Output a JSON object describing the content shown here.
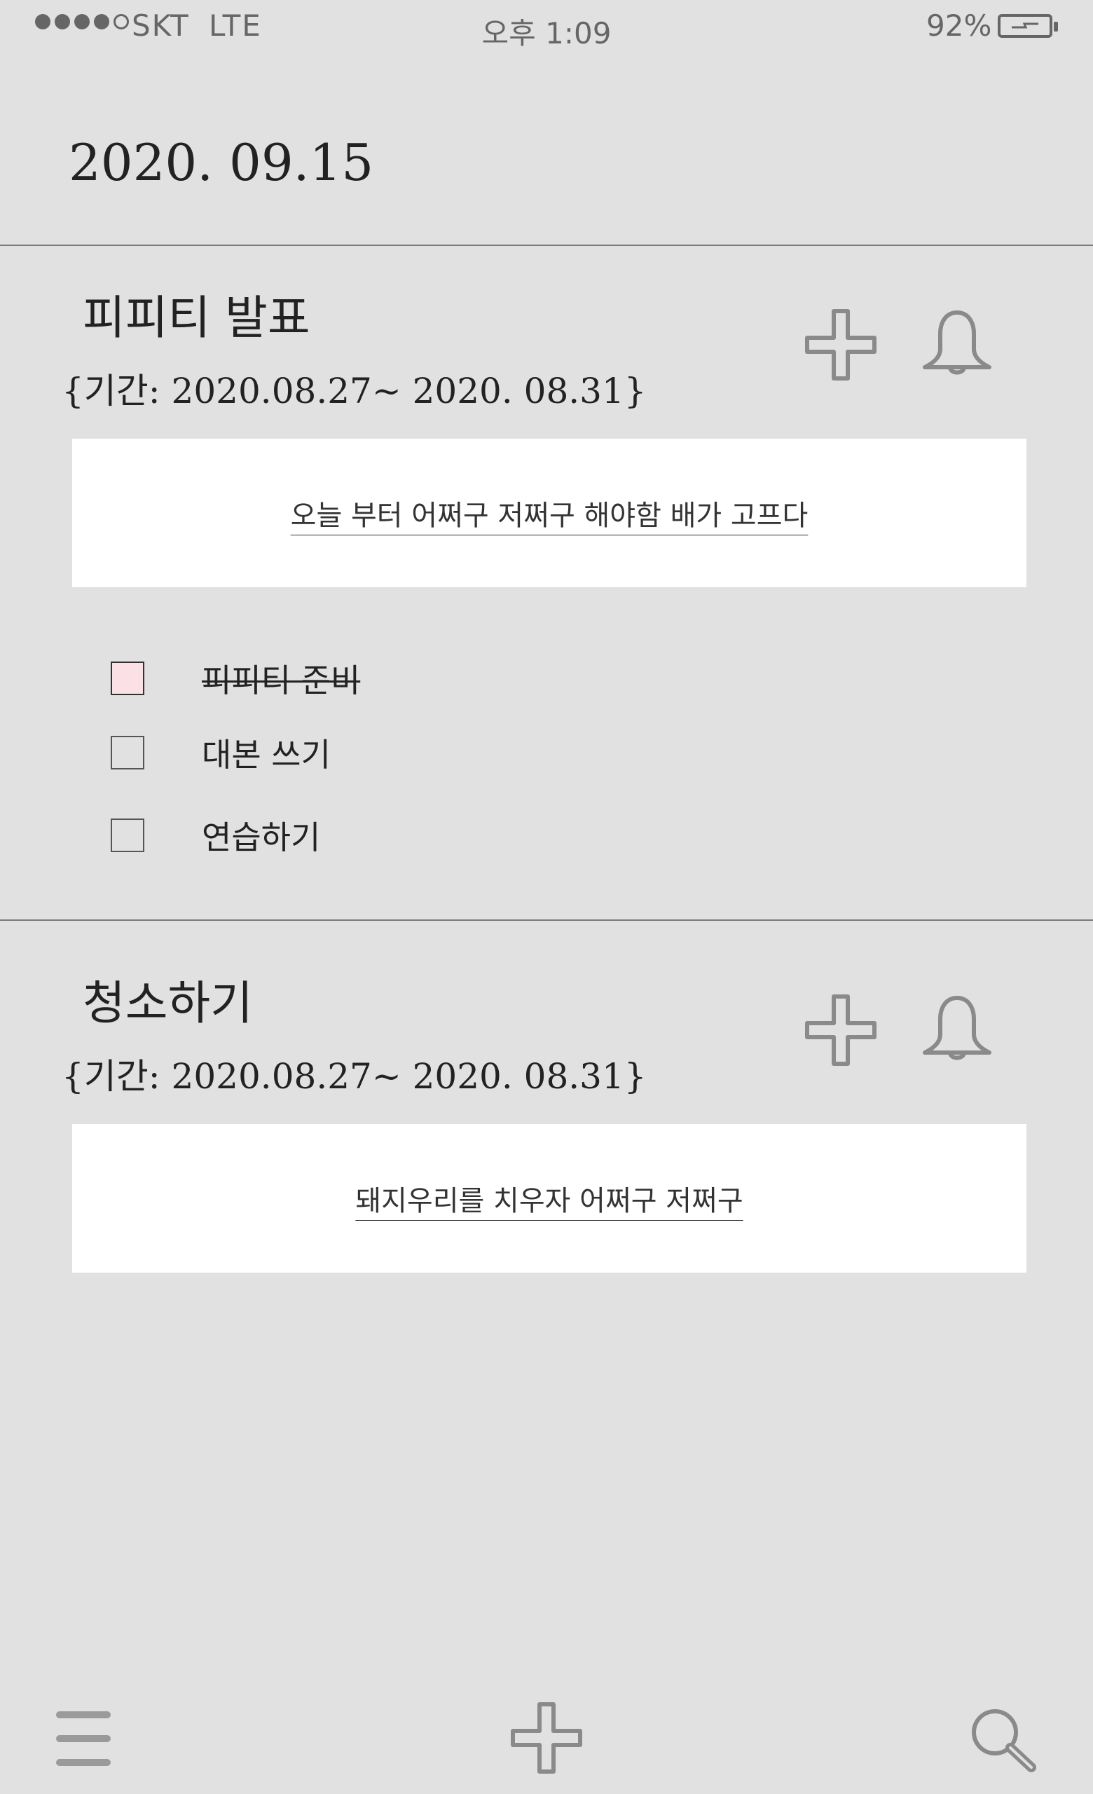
{
  "status_bar": {
    "carrier": "SKT",
    "network": "LTE",
    "time": "오후 1:09",
    "battery": "92%"
  },
  "date": "2020. 09.15",
  "tasks": [
    {
      "title": "피피티 발표",
      "period": "{기간: 2020.08.27~ 2020. 08.31}",
      "memo": "오늘 부터 어쩌구 저쩌구 해야함 배가 고프다",
      "checklist": [
        {
          "label": "피피티 준비",
          "checked": true
        },
        {
          "label": "대본 쓰기",
          "checked": false
        },
        {
          "label": "연습하기",
          "checked": false
        }
      ]
    },
    {
      "title": "청소하기",
      "period": "{기간: 2020.08.27~ 2020. 08.31}",
      "memo": "돼지우리를 치우자 어쩌구 저쩌구"
    }
  ],
  "icons": {
    "add": "plus-icon",
    "alarm": "bell-icon",
    "menu": "hamburger-menu-icon",
    "search": "search-icon"
  },
  "colors": {
    "background": "#e1e1e1",
    "checked_box": "#fbe1e5",
    "icon": "#8a8a8a"
  }
}
